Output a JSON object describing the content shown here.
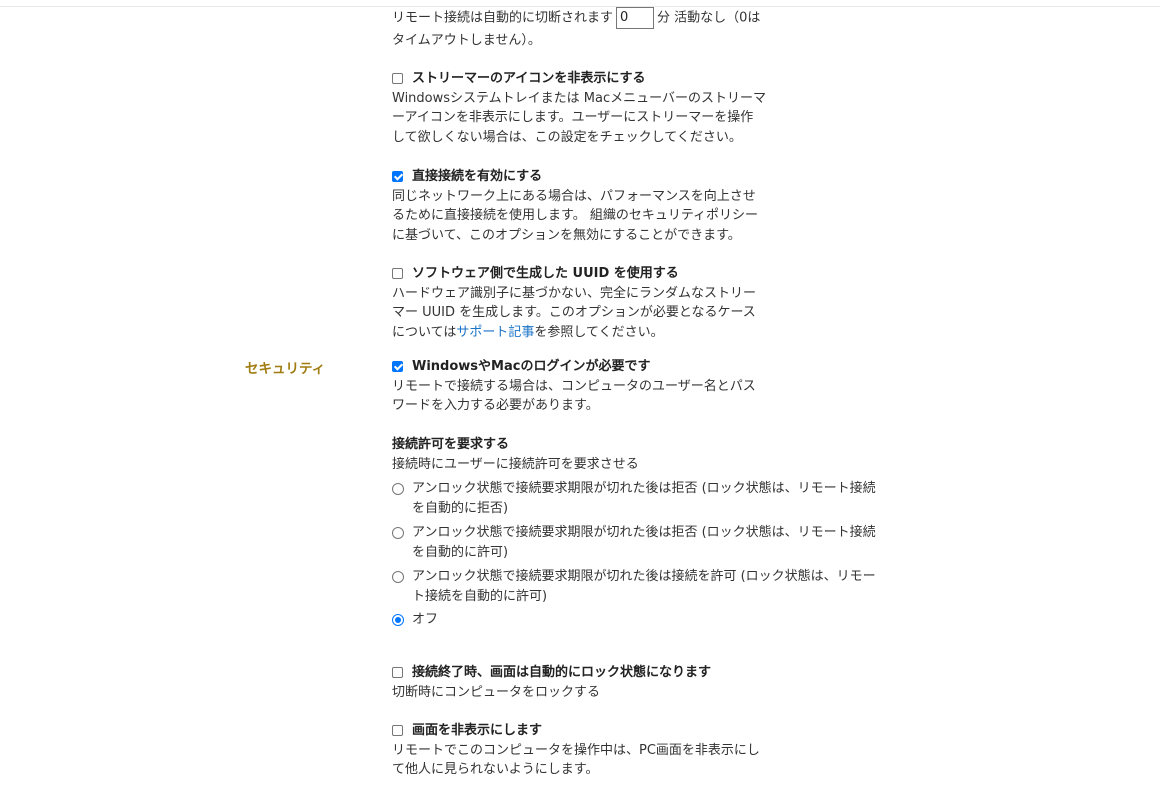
{
  "timeout": {
    "text_before": "リモート接続は自動的に切断されます",
    "input_value": "0",
    "text_after": "分 活動なし（0は",
    "line2": "タイムアウトしません）。"
  },
  "hide_icon": {
    "checked": false,
    "title": "ストリーマーのアイコンを非表示にする",
    "desc": [
      "Windowsシステムトレイまたは Macメニューバーのストリーマ",
      "ーアイコンを非表示にします。ユーザーにストリーマーを操作",
      "して欲しくない場合は、この設定をチェックしてください。"
    ]
  },
  "direct": {
    "checked": true,
    "title": "直接接続を有効にする",
    "desc": [
      "同じネットワーク上にある場合は、パフォーマンスを向上させ",
      "るために直接接続を使用します。 組織のセキュリティポリシー",
      "に基づいて、このオプションを無効にすることができます。"
    ]
  },
  "uuid": {
    "checked": false,
    "title": "ソフトウェア側で生成した UUID を使用する",
    "desc": [
      "ハードウェア識別子に基づかない、完全にランダムなストリー",
      "マー UUID を生成します。このオプションが必要となるケース"
    ],
    "desc3_before": "については",
    "desc3_link": "サポート記事",
    "desc3_after": "を参照してください。"
  },
  "security": {
    "label": "セキュリティ",
    "login": {
      "checked": true,
      "title": "WindowsやMacのログインが必要です",
      "desc": [
        "リモートで接続する場合は、コンピュータのユーザー名とパス",
        "ワードを入力する必要があります。"
      ]
    },
    "permission": {
      "title": "接続許可を要求する",
      "desc": "接続時にユーザーに接続許可を要求させる",
      "options": [
        {
          "line1": "アンロック状態で接続要求期限が切れた後は拒否 (ロック状態は、リモート接続",
          "line2": "を自動的に拒否)",
          "selected": false
        },
        {
          "line1": "アンロック状態で接続要求期限が切れた後は拒否 (ロック状態は、リモート接続",
          "line2": "を自動的に許可)",
          "selected": false
        },
        {
          "line1": "アンロック状態で接続要求期限が切れた後は接続を許可 (ロック状態は、リモー",
          "line2": "ト接続を自動的に許可)",
          "selected": false
        },
        {
          "line1": "オフ",
          "line2": "",
          "selected": true
        }
      ]
    },
    "lock": {
      "checked": false,
      "title": "接続終了時、画面は自動的にロック状態になります",
      "desc": "切断時にコンピュータをロックする"
    },
    "hide_screen": {
      "checked": false,
      "title": "画面を非表示にします",
      "desc": [
        "リモートでこのコンピュータを操作中は、PC画面を非表示にし",
        "て他人に見られないようにします。"
      ]
    }
  }
}
